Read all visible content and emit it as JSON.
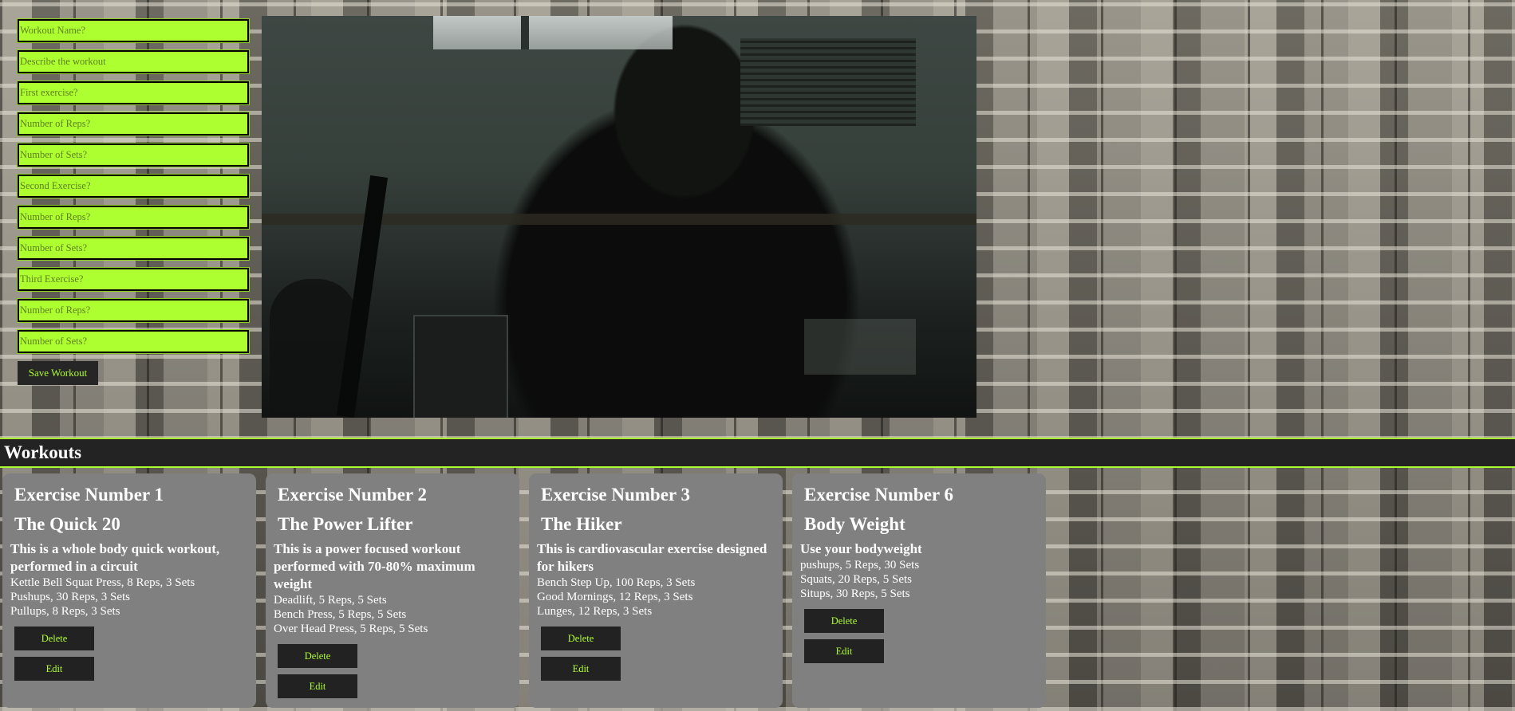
{
  "form": {
    "fields": [
      {
        "placeholder": "Workout Name?",
        "value": ""
      },
      {
        "placeholder": "Describe the workout",
        "value": ""
      },
      {
        "placeholder": "First exercise?",
        "value": ""
      },
      {
        "placeholder": "Number of Reps?",
        "value": ""
      },
      {
        "placeholder": "Number of Sets?",
        "value": ""
      },
      {
        "placeholder": "Second Exercise?",
        "value": ""
      },
      {
        "placeholder": "Number of Reps?",
        "value": ""
      },
      {
        "placeholder": "Number of Sets?",
        "value": ""
      },
      {
        "placeholder": "Third Exercise?",
        "value": ""
      },
      {
        "placeholder": "Number of Reps?",
        "value": ""
      },
      {
        "placeholder": "Number of Sets?",
        "value": ""
      }
    ],
    "save_label": "Save Workout"
  },
  "section_title": "Workouts",
  "cards": [
    {
      "number_label": "Exercise Number 1",
      "name": "The Quick 20",
      "description": "This is a whole body quick workout, performed in a circuit",
      "exercises": [
        "Kettle Bell Squat Press, 8 Reps, 3 Sets",
        "Pushups, 30 Reps, 3 Sets",
        "Pullups, 8 Reps, 3 Sets"
      ],
      "delete_label": "Delete",
      "edit_label": "Edit"
    },
    {
      "number_label": "Exercise Number 2",
      "name": "The Power Lifter",
      "description": "This is a power focused workout performed with 70-80% maximum weight",
      "exercises": [
        "Deadlift, 5 Reps, 5 Sets",
        "Bench Press, 5 Reps, 5 Sets",
        "Over Head Press, 5 Reps, 5 Sets"
      ],
      "delete_label": "Delete",
      "edit_label": "Edit"
    },
    {
      "number_label": "Exercise Number 3",
      "name": "The Hiker",
      "description": "This is cardiovascular exercise designed for hikers",
      "exercises": [
        "Bench Step Up, 100 Reps, 3 Sets",
        "Good Mornings, 12 Reps, 3 Sets",
        "Lunges, 12 Reps, 3 Sets"
      ],
      "delete_label": "Delete",
      "edit_label": "Edit"
    },
    {
      "number_label": "Exercise Number 6",
      "name": "Body Weight",
      "description": "Use your bodyweight",
      "exercises": [
        "pushups, 5 Reps, 30 Sets",
        "Squats, 20 Reps, 5 Sets",
        "Situps, 30 Reps, 5 Sets"
      ],
      "delete_label": "Delete",
      "edit_label": "Edit"
    }
  ],
  "colors": {
    "accent": "#adff2f",
    "card_bg": "#808080",
    "button_bg": "#222222",
    "bar_bg": "#232323"
  }
}
